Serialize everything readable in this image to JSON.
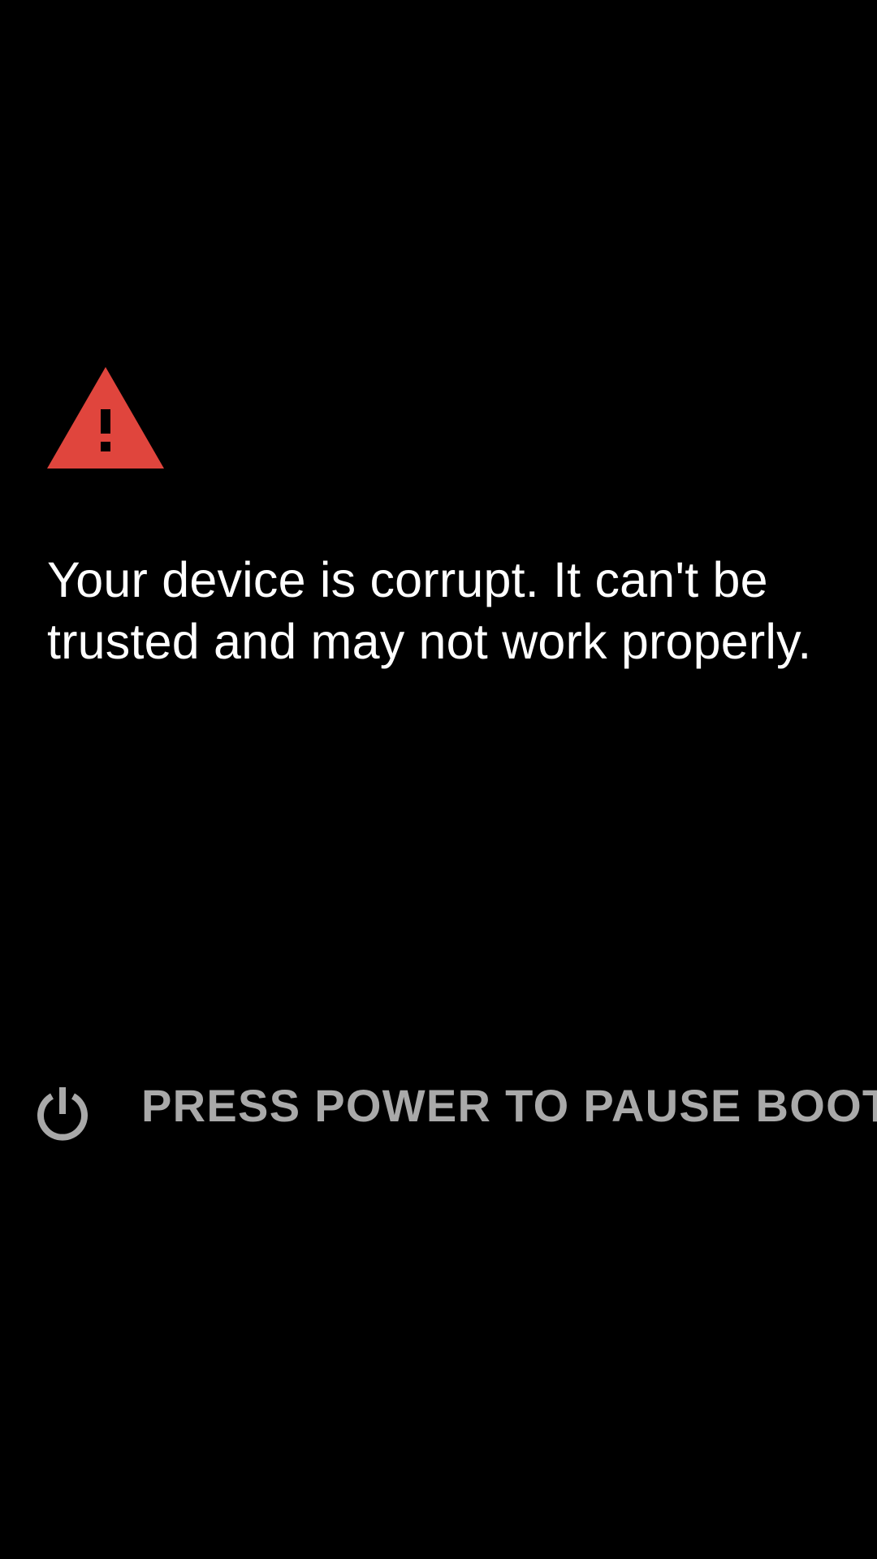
{
  "colors": {
    "background": "#000000",
    "warning": "#e0453d",
    "message_text": "#ffffff",
    "boot_text": "#a9a9a9"
  },
  "warning": {
    "icon": "warning-icon"
  },
  "message": {
    "text": "Your device is corrupt. It can't be trusted and may not work properly."
  },
  "boot_option": {
    "icon": "power-icon",
    "label": "PRESS POWER TO PAUSE BOOT"
  }
}
